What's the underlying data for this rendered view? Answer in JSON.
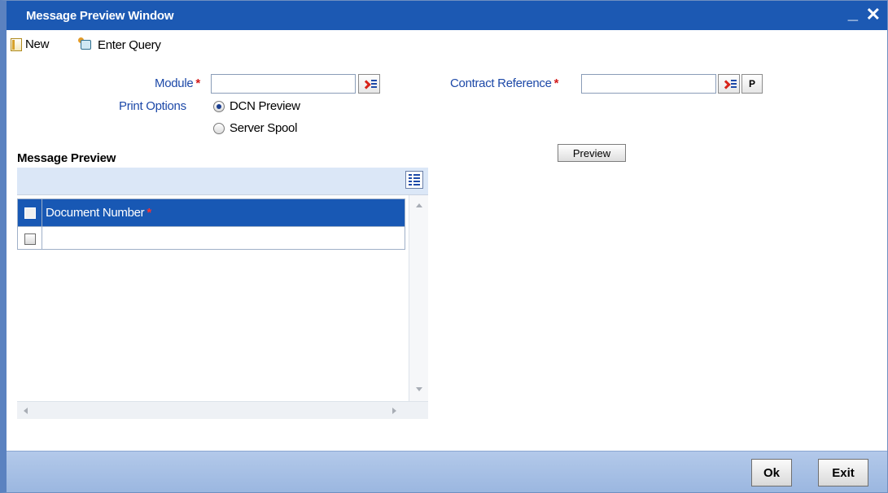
{
  "window": {
    "title": "Message Preview Window",
    "minimize_glyph": "_",
    "close_glyph": "✕"
  },
  "toolbar": {
    "new_label": "New",
    "enter_query_label": "Enter Query"
  },
  "form": {
    "module_label": "Module",
    "module_value": "",
    "required_mark": "*",
    "contract_reference_label": "Contract Reference",
    "contract_reference_value": "",
    "p_button_label": "P",
    "print_options_label": "Print Options",
    "print_options": [
      {
        "label": "DCN Preview",
        "selected": true
      },
      {
        "label": "Server Spool",
        "selected": false
      }
    ],
    "preview_button_label": "Preview"
  },
  "message_preview": {
    "title": "Message Preview",
    "columns": [
      {
        "header": "Document Number",
        "required": true
      }
    ],
    "rows": [
      {
        "document_number": ""
      }
    ]
  },
  "footer": {
    "ok_label": "Ok",
    "exit_label": "Exit"
  },
  "icons": [
    "new-document-icon",
    "enter-query-icon",
    "lov-list-icon",
    "grid-options-icon"
  ],
  "colors": {
    "titlebar": "#1c59b3",
    "grid_header": "#1858b4",
    "label": "#1d49a8",
    "required": "#d21a1a",
    "footer": "#a8c0e6"
  }
}
